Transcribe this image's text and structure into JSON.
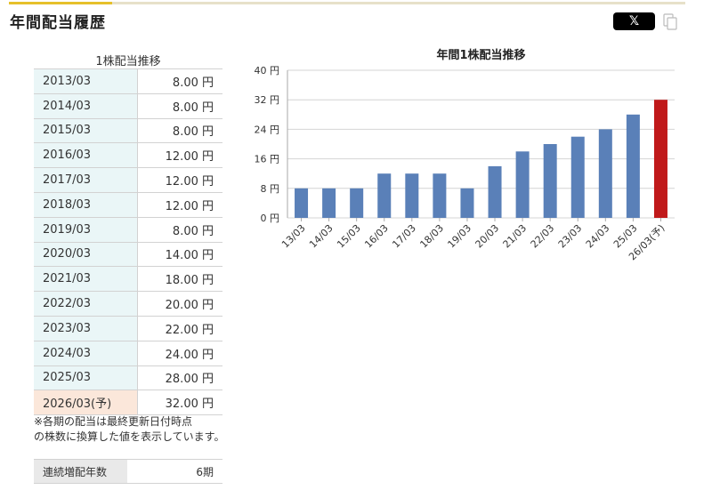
{
  "page": {
    "title": "年間配当履歴",
    "share_x_label": "𝕏",
    "copy_icon": "copy-icon"
  },
  "table": {
    "title": "1株配当推移",
    "rows": [
      {
        "year": "2013/03",
        "value": "8.00 円",
        "forecast": false
      },
      {
        "year": "2014/03",
        "value": "8.00 円",
        "forecast": false
      },
      {
        "year": "2015/03",
        "value": "8.00 円",
        "forecast": false
      },
      {
        "year": "2016/03",
        "value": "12.00 円",
        "forecast": false
      },
      {
        "year": "2017/03",
        "value": "12.00 円",
        "forecast": false
      },
      {
        "year": "2018/03",
        "value": "12.00 円",
        "forecast": false
      },
      {
        "year": "2019/03",
        "value": "8.00 円",
        "forecast": false
      },
      {
        "year": "2020/03",
        "value": "14.00 円",
        "forecast": false
      },
      {
        "year": "2021/03",
        "value": "18.00 円",
        "forecast": false
      },
      {
        "year": "2022/03",
        "value": "20.00 円",
        "forecast": false
      },
      {
        "year": "2023/03",
        "value": "22.00 円",
        "forecast": false
      },
      {
        "year": "2024/03",
        "value": "24.00 円",
        "forecast": false
      },
      {
        "year": "2025/03",
        "value": "28.00 円",
        "forecast": false
      },
      {
        "year": "2026/03(予)",
        "value": "32.00 円",
        "forecast": true
      }
    ],
    "note_line1": "※各期の配当は最終更新日付時点",
    "note_line2": "の株数に換算した値を表示しています。"
  },
  "streak": {
    "label": "連続増配年数",
    "value": "6期"
  },
  "chart_data": {
    "type": "bar",
    "title": "年間1株配当推移",
    "categories": [
      "13/03",
      "14/03",
      "15/03",
      "16/03",
      "17/03",
      "18/03",
      "19/03",
      "20/03",
      "21/03",
      "22/03",
      "23/03",
      "24/03",
      "25/03",
      "26/03(予)"
    ],
    "values": [
      8,
      8,
      8,
      12,
      12,
      12,
      8,
      14,
      18,
      20,
      22,
      24,
      28,
      32
    ],
    "forecast_index": 13,
    "y_ticks": [
      "0 円",
      "8 円",
      "16 円",
      "24 円",
      "32 円",
      "40 円"
    ],
    "ylim": [
      0,
      40
    ],
    "grid": true,
    "colors": {
      "actual": "#5a80b8",
      "forecast": "#c0191a",
      "grid": "#d4d4d4"
    }
  }
}
